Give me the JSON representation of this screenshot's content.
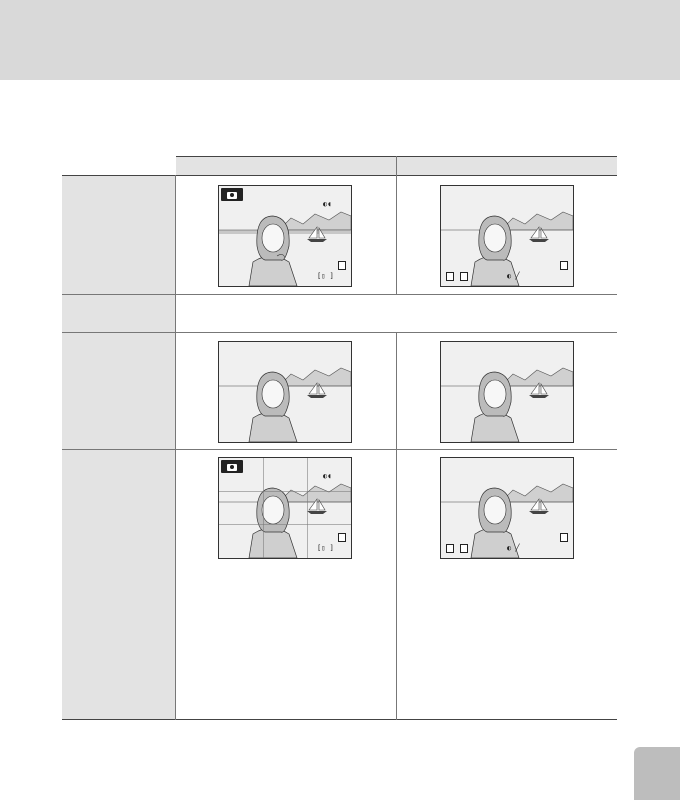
{
  "page": {
    "header_title": "",
    "side_tab_label": ""
  },
  "table": {
    "columns": [
      "",
      ""
    ],
    "rows": [
      {
        "label": "",
        "content": ""
      },
      {
        "label": "",
        "content": ""
      },
      {
        "label": "",
        "content": ""
      },
      {
        "label": "",
        "content": ""
      }
    ]
  },
  "thumbnails": {
    "icons": [
      "camera-mode-icon",
      "vibration-reduction-icon",
      "image-size-icon",
      "focus-bracket-icon",
      "battery-icon",
      "flash-icon"
    ]
  }
}
